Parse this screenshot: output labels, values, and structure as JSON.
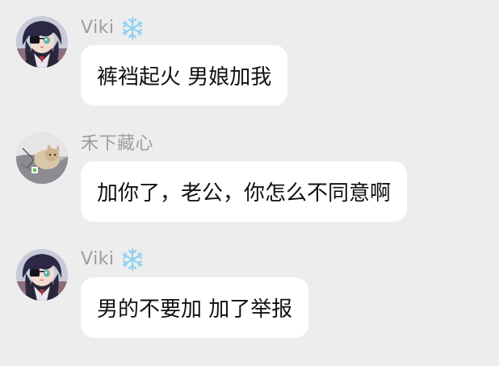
{
  "chat": {
    "messages": [
      {
        "sender": "Viki",
        "sender_badge": "snowflake-icon",
        "avatar": "anime-girl-avatar",
        "text": "裤裆起火  男娘加我"
      },
      {
        "sender": "禾下藏心",
        "sender_badge": "",
        "avatar": "cat-photo-avatar",
        "text": "加你了，老公，你怎么不同意啊"
      },
      {
        "sender": "Viki",
        "sender_badge": "snowflake-icon",
        "avatar": "anime-girl-avatar",
        "text": "男的不要加 加了举报"
      }
    ]
  },
  "colors": {
    "background": "#ededed",
    "bubble": "#ffffff",
    "sender_name": "#9d9d9d",
    "text": "#111111",
    "snowflake": "#8fd3ec"
  }
}
